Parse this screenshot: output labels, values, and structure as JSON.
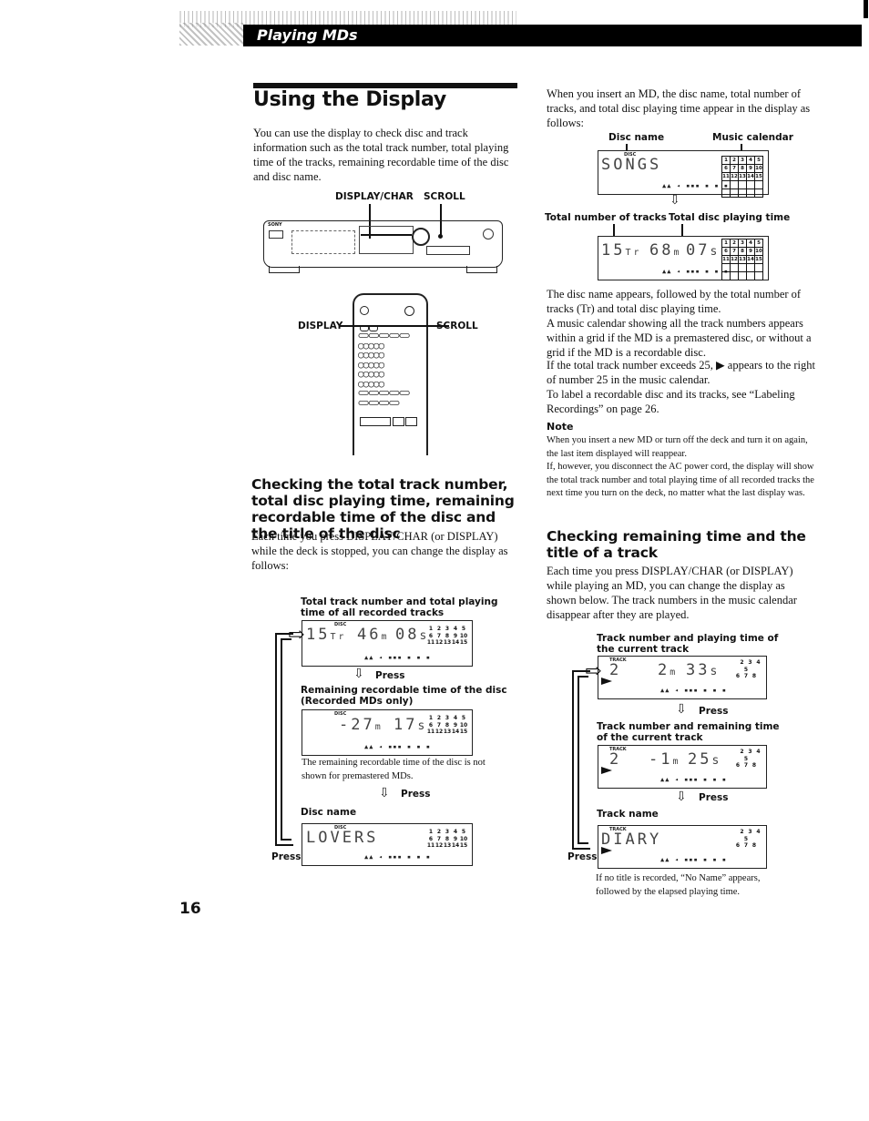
{
  "header": {
    "section_title": "Playing MDs"
  },
  "page_number": "16",
  "main": {
    "title": "Using the Display",
    "intro": "You can use the display to check disc and track information such as the total track number, total playing time of the tracks, remaining recordable time of the disc and disc name.",
    "deck_labels": {
      "display_char": "DISPLAY/CHAR",
      "scroll": "SCROLL",
      "brand": "SONY"
    },
    "remote_labels": {
      "display": "DISPLAY",
      "scroll": "SCROLL"
    },
    "section1": {
      "heading": "Checking the total track number, total disc playing time, remaining recordable time of the disc and the title of the disc",
      "text": "Each time you press DISPLAY/CHAR (or DISPLAY) while the deck is stopped, you can change the display as follows:",
      "step1_label": "Total track number and total playing time of all recorded tracks",
      "step1_display": {
        "tracks": "15",
        "tr": "Tr",
        "minutes": "46",
        "m": "m",
        "seconds": "08",
        "s": "s",
        "indicator": "DISC"
      },
      "press": "Press",
      "step2_label": "Remaining recordable time of the disc (Recorded MDs only)",
      "step2_display": {
        "minutes": "-27",
        "m": "m",
        "seconds": "17",
        "s": "s",
        "indicator": "DISC"
      },
      "step2_note": "The remaining recordable time of the disc is not shown for premastered MDs.",
      "step3_label": "Disc name",
      "step3_display": {
        "name": "LOVERS",
        "indicator": "DISC"
      },
      "loop_press": "Press"
    }
  },
  "right": {
    "intro": "When you insert an MD, the disc name, total number of tracks, and total disc playing time appear in the display as follows:",
    "labels": {
      "disc_name": "Disc name",
      "music_calendar": "Music calendar",
      "total_tracks": "Total number of tracks",
      "total_time": "Total disc playing time"
    },
    "display1": {
      "name": "SONGS",
      "indicator": "DISC"
    },
    "display2": {
      "tracks": "15",
      "tr": "Tr",
      "minutes": "68",
      "m": "m",
      "seconds": "07",
      "s": "s"
    },
    "calendar": [
      "1",
      "2",
      "3",
      "4",
      "5",
      "6",
      "7",
      "8",
      "9",
      "10",
      "11",
      "12",
      "13",
      "14",
      "15"
    ],
    "paragraphs": [
      "The disc name appears, followed by the total number of tracks (Tr) and total disc playing time.",
      "A music calendar showing all the track numbers appears within a grid if the MD is a premastered disc, or without a grid if the MD is a recordable disc.",
      "If the total track number exceeds 25, ▶ appears to the right of number 25 in the music calendar.",
      "To label a recordable disc and its tracks, see “Labeling Recordings” on page 26."
    ],
    "note": {
      "heading": "Note",
      "text1": "When you insert a new MD or turn off the deck and turn it on again, the last item displayed will reappear.",
      "text2": "If, however, you disconnect the AC power cord, the display will show the total track number and total playing time of all recorded tracks the next time you turn on the deck, no matter what the last display was."
    },
    "section2": {
      "heading": "Checking remaining time and the title of a track",
      "text": "Each time you press DISPLAY/CHAR (or DISPLAY) while playing an MD, you can change the display as shown below.  The track numbers in the music calendar disappear after they are played.",
      "step1_label": "Track number and playing time of the current track",
      "step1_display": {
        "track": "2",
        "minutes": "2",
        "m": "m",
        "seconds": "33",
        "s": "s",
        "indicator": "TRACK"
      },
      "press": "Press",
      "step2_label": "Track number and remaining time of the current track",
      "step2_display": {
        "track": "2",
        "minutes": "-1",
        "m": "m",
        "seconds": "25",
        "s": "s",
        "indicator": "TRACK"
      },
      "step3_label": "Track name",
      "step3_display": {
        "name": "DIARY",
        "indicator": "TRACK"
      },
      "loop_press": "Press",
      "footnote": "If no title is recorded, “No Name” appears, followed by the elapsed playing time."
    },
    "remaining_calendar": [
      "2",
      "3",
      "4",
      "5",
      "6",
      "7",
      "8"
    ]
  },
  "level_meter": "▲▲ ◂ ▪▪▪ ▪ ▪ ▪"
}
